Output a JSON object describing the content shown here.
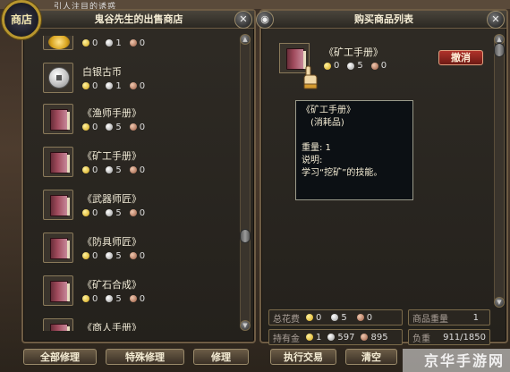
{
  "top_strip_text": "引人注目的诱惑",
  "emblem_label": "商店",
  "shop": {
    "title": "鬼谷先生的出售商店",
    "items": [
      {
        "name": "",
        "icon": "gold-ingot-icon",
        "price": {
          "gold": "0",
          "silver": "1",
          "copper": "0"
        }
      },
      {
        "name": "白银古币",
        "icon": "silver-coin-icon",
        "price": {
          "gold": "0",
          "silver": "1",
          "copper": "0"
        }
      },
      {
        "name": "《渔师手册》",
        "icon": "book-icon",
        "price": {
          "gold": "0",
          "silver": "5",
          "copper": "0"
        }
      },
      {
        "name": "《矿工手册》",
        "icon": "book-icon",
        "price": {
          "gold": "0",
          "silver": "5",
          "copper": "0"
        }
      },
      {
        "name": "《武器师匠》",
        "icon": "book-icon",
        "price": {
          "gold": "0",
          "silver": "5",
          "copper": "0"
        }
      },
      {
        "name": "《防具师匠》",
        "icon": "book-icon",
        "price": {
          "gold": "0",
          "silver": "5",
          "copper": "0"
        }
      },
      {
        "name": "《矿石合成》",
        "icon": "book-icon",
        "price": {
          "gold": "0",
          "silver": "5",
          "copper": "0"
        }
      },
      {
        "name": "《商人手册》",
        "icon": "book-icon",
        "price": {
          "gold": "",
          "silver": "",
          "copper": ""
        }
      }
    ],
    "buttons": {
      "repair_all": "全部修理",
      "special_repair": "特殊修理",
      "repair": "修理"
    }
  },
  "cart": {
    "title": "购买商品列表",
    "item": {
      "name": "《矿工手册》",
      "price": {
        "gold": "0",
        "silver": "5",
        "copper": "0"
      }
    },
    "cancel_label": "撤消",
    "tooltip": {
      "name": "《矿工手册》",
      "type": "(消耗品)",
      "weight": "重量: 1",
      "desc_label": "说明:",
      "desc": "学习“挖矿”的技能。"
    },
    "summary": {
      "total_label": "总花费",
      "total": {
        "gold": "0",
        "silver": "5",
        "copper": "0"
      },
      "weight_label": "商品重量",
      "weight": "1",
      "owned_label": "持有金",
      "owned": {
        "gold": "1",
        "silver": "597",
        "copper": "895"
      },
      "load_label": "负重",
      "load": "911/1850"
    },
    "buttons": {
      "execute": "执行交易",
      "clear": "清空"
    }
  },
  "watermark": "京华手游网",
  "colors": {
    "gold": "#d4a414",
    "silver": "#9a9a9a",
    "copper": "#9a5a40",
    "cancel": "#b0322a",
    "border": "#6e5c44"
  }
}
